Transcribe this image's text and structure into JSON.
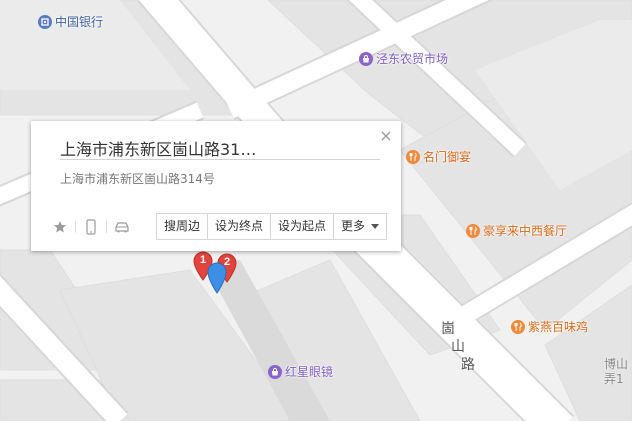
{
  "map": {
    "background": "#f1f1f1",
    "block_color": "#e4e4e5",
    "road_color": "#ffffff",
    "road_edge_color": "#d9d9d9"
  },
  "pois": [
    {
      "key": "bank",
      "name": "中国银行",
      "category": "bank",
      "icon": "bank-icon",
      "color": "#5a7bc0"
    },
    {
      "key": "market",
      "name": "泾东农贸市场",
      "category": "market",
      "icon": "shopping-icon",
      "color": "#8a64c8"
    },
    {
      "key": "rest1",
      "name": "名门御宴",
      "category": "restaurant",
      "icon": "restaurant-icon",
      "color": "#f08a3c"
    },
    {
      "key": "rest2",
      "name": "豪享来中西餐厅",
      "category": "restaurant",
      "icon": "restaurant-icon",
      "color": "#f08a3c"
    },
    {
      "key": "rest3",
      "name": "紫燕百味鸡",
      "category": "restaurant",
      "icon": "restaurant-icon",
      "color": "#f08a3c"
    },
    {
      "key": "glasses",
      "name": "红星眼镜",
      "category": "shop",
      "icon": "shopping-icon",
      "color": "#8a64c8"
    }
  ],
  "street": {
    "name_chars": [
      "崮",
      "山",
      "路"
    ]
  },
  "edge_label": {
    "lines": [
      "博山",
      "弄1"
    ]
  },
  "info_window": {
    "title": "上海市浦东新区崮山路31…",
    "address": "上海市浦东新区崮山路314号",
    "tools": [
      "star-icon",
      "phone-icon",
      "car-icon"
    ],
    "actions": {
      "nearby": "搜周边",
      "set_end": "设为终点",
      "set_start": "设为起点",
      "more": "更多"
    }
  },
  "markers": [
    {
      "label": "1",
      "color": "#e2433c"
    },
    {
      "label": "2",
      "color": "#e2433c"
    },
    {
      "label": "",
      "color": "#3d8fe6"
    }
  ]
}
